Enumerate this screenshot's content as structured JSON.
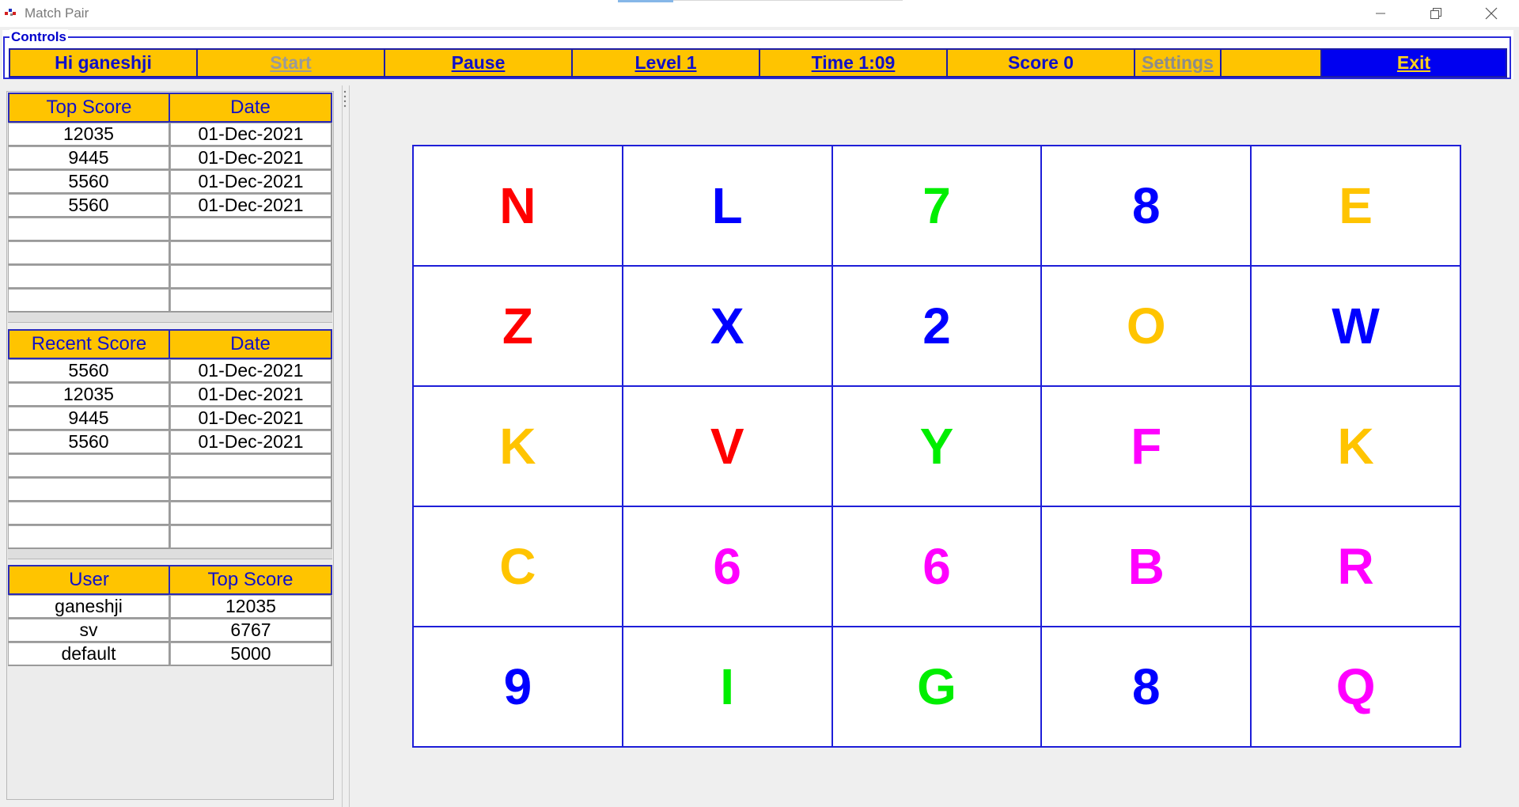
{
  "window": {
    "title": "Match Pair",
    "icon": "app-icon",
    "controls": [
      "minimize-icon",
      "restore-icon",
      "close-icon"
    ]
  },
  "controls": {
    "legend": "Controls",
    "greeting": "Hi ganeshji",
    "start_label": "Start",
    "pause_label": "Pause",
    "level_label": "Level 1",
    "time_label": "Time 1:09",
    "score_label": "Score 0",
    "settings_label": "Settings",
    "exit_label": "Exit",
    "colors": {
      "button_bg": "#ffc400",
      "button_text": "#1010c8",
      "exit_bg": "#0000f0",
      "exit_text": "#ffd21a",
      "disabled_text": "#9a9a9a"
    }
  },
  "top_scores": {
    "headers": [
      "Top Score",
      "Date"
    ],
    "rows": [
      [
        "12035",
        "01-Dec-2021"
      ],
      [
        "9445",
        "01-Dec-2021"
      ],
      [
        "5560",
        "01-Dec-2021"
      ],
      [
        "5560",
        "01-Dec-2021"
      ],
      [
        "",
        ""
      ],
      [
        "",
        ""
      ],
      [
        "",
        ""
      ],
      [
        "",
        ""
      ]
    ]
  },
  "recent_scores": {
    "headers": [
      "Recent Score",
      "Date"
    ],
    "rows": [
      [
        "5560",
        "01-Dec-2021"
      ],
      [
        "12035",
        "01-Dec-2021"
      ],
      [
        "9445",
        "01-Dec-2021"
      ],
      [
        "5560",
        "01-Dec-2021"
      ],
      [
        "",
        ""
      ],
      [
        "",
        ""
      ],
      [
        "",
        ""
      ],
      [
        "",
        ""
      ]
    ]
  },
  "users": {
    "headers": [
      "User",
      "Top Score"
    ],
    "rows": [
      [
        "ganeshji",
        "12035"
      ],
      [
        "sv",
        "6767"
      ],
      [
        "default",
        "5000"
      ]
    ]
  },
  "board": {
    "columns": 5,
    "cells": [
      {
        "text": "N",
        "color": "#ff0000"
      },
      {
        "text": "L",
        "color": "#0000ff"
      },
      {
        "text": "7",
        "color": "#00ee00"
      },
      {
        "text": "8",
        "color": "#0000ff"
      },
      {
        "text": "E",
        "color": "#ffc400"
      },
      {
        "text": "Z",
        "color": "#ff0000"
      },
      {
        "text": "X",
        "color": "#0000ff"
      },
      {
        "text": "2",
        "color": "#0000ff"
      },
      {
        "text": "O",
        "color": "#ffc400"
      },
      {
        "text": "W",
        "color": "#0000ff"
      },
      {
        "text": "K",
        "color": "#ffc400"
      },
      {
        "text": "V",
        "color": "#ff0000"
      },
      {
        "text": "Y",
        "color": "#00ee00"
      },
      {
        "text": "F",
        "color": "#ff00ff"
      },
      {
        "text": "K",
        "color": "#ffc400"
      },
      {
        "text": "C",
        "color": "#ffc400"
      },
      {
        "text": "6",
        "color": "#ff00ff"
      },
      {
        "text": "6",
        "color": "#ff00ff"
      },
      {
        "text": "B",
        "color": "#ff00ff"
      },
      {
        "text": "R",
        "color": "#ff00ff"
      },
      {
        "text": "9",
        "color": "#0000ff"
      },
      {
        "text": "I",
        "color": "#00ee00"
      },
      {
        "text": "G",
        "color": "#00ee00"
      },
      {
        "text": "8",
        "color": "#0000ff"
      },
      {
        "text": "Q",
        "color": "#ff00ff"
      }
    ]
  }
}
